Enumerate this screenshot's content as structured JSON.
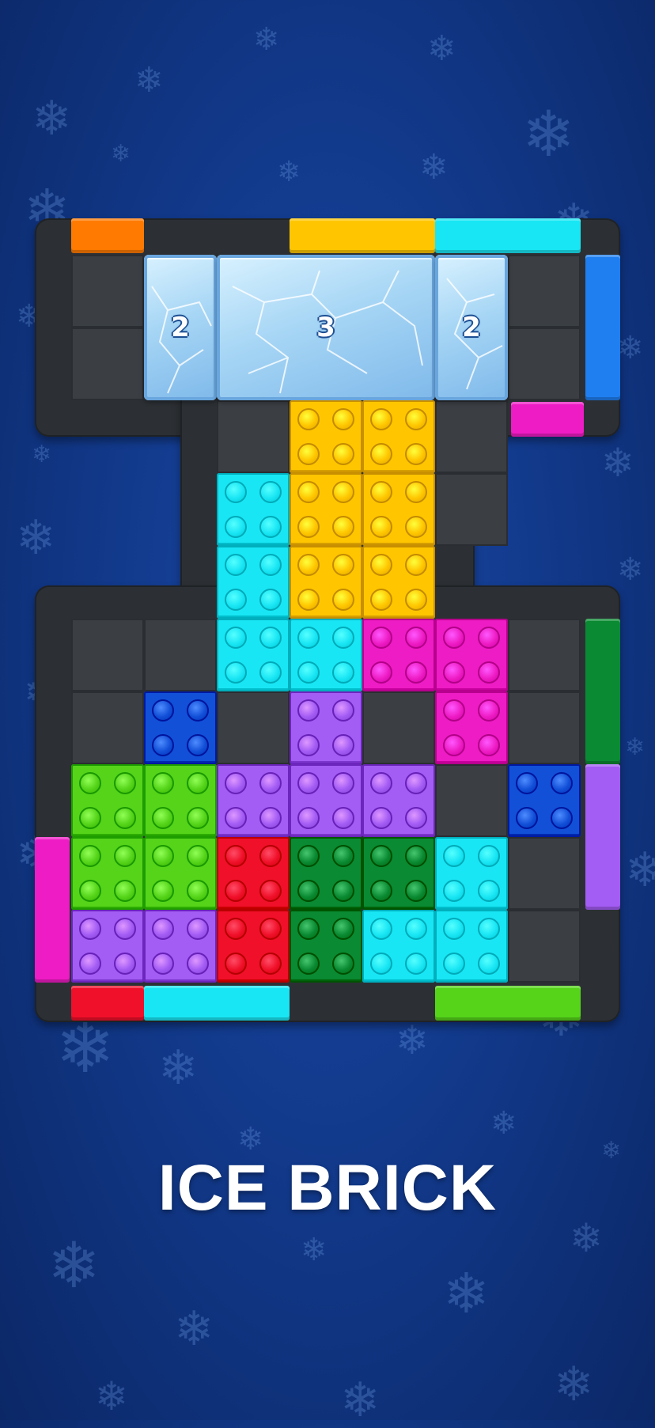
{
  "game_title": "ICE BRICK",
  "colors": {
    "background": "#123a8c",
    "frame": "#2c3034",
    "empty_cell": "#3b3f44",
    "orange": "#ff7a00",
    "yellow": "#ffc600",
    "cyan": "#19e6f4",
    "blue": "#1f7ff0",
    "magenta": "#ee1cc4",
    "green": "#0a8a32",
    "purple": "#a35cf4",
    "red": "#f0102a",
    "lime": "#55d41a",
    "dark_blue": "#1250d8"
  },
  "ice_blocks": [
    {
      "id": "ice-left",
      "hits_remaining": "2"
    },
    {
      "id": "ice-middle",
      "hits_remaining": "3"
    },
    {
      "id": "ice-right",
      "hits_remaining": "2"
    }
  ],
  "pieces": [
    {
      "name": "yellow-piece",
      "color": "yellow"
    },
    {
      "name": "cyan-tall-piece",
      "color": "cyan"
    },
    {
      "name": "magenta-piece",
      "color": "magenta"
    },
    {
      "name": "blue-small-piece-left",
      "color": "dark_blue"
    },
    {
      "name": "purple-t-piece",
      "color": "purple"
    },
    {
      "name": "green-square-piece",
      "color": "lime"
    },
    {
      "name": "blue-small-piece-right",
      "color": "dark_blue"
    },
    {
      "name": "red-piece",
      "color": "red"
    },
    {
      "name": "dark-green-piece",
      "color": "green"
    },
    {
      "name": "cyan-bottom-piece",
      "color": "cyan"
    },
    {
      "name": "purple-bottom-piece",
      "color": "purple"
    }
  ],
  "exit_gates": [
    {
      "name": "gate-top-orange",
      "color": "orange"
    },
    {
      "name": "gate-top-yellow",
      "color": "yellow"
    },
    {
      "name": "gate-top-cyan",
      "color": "cyan"
    },
    {
      "name": "gate-right-blue",
      "color": "blue"
    },
    {
      "name": "gate-top-magenta",
      "color": "magenta"
    },
    {
      "name": "gate-right-green",
      "color": "green"
    },
    {
      "name": "gate-right-purple",
      "color": "purple"
    },
    {
      "name": "gate-left-magenta",
      "color": "magenta"
    },
    {
      "name": "gate-bottom-red",
      "color": "red"
    },
    {
      "name": "gate-bottom-cyan",
      "color": "cyan"
    },
    {
      "name": "gate-bottom-lime",
      "color": "lime"
    }
  ]
}
